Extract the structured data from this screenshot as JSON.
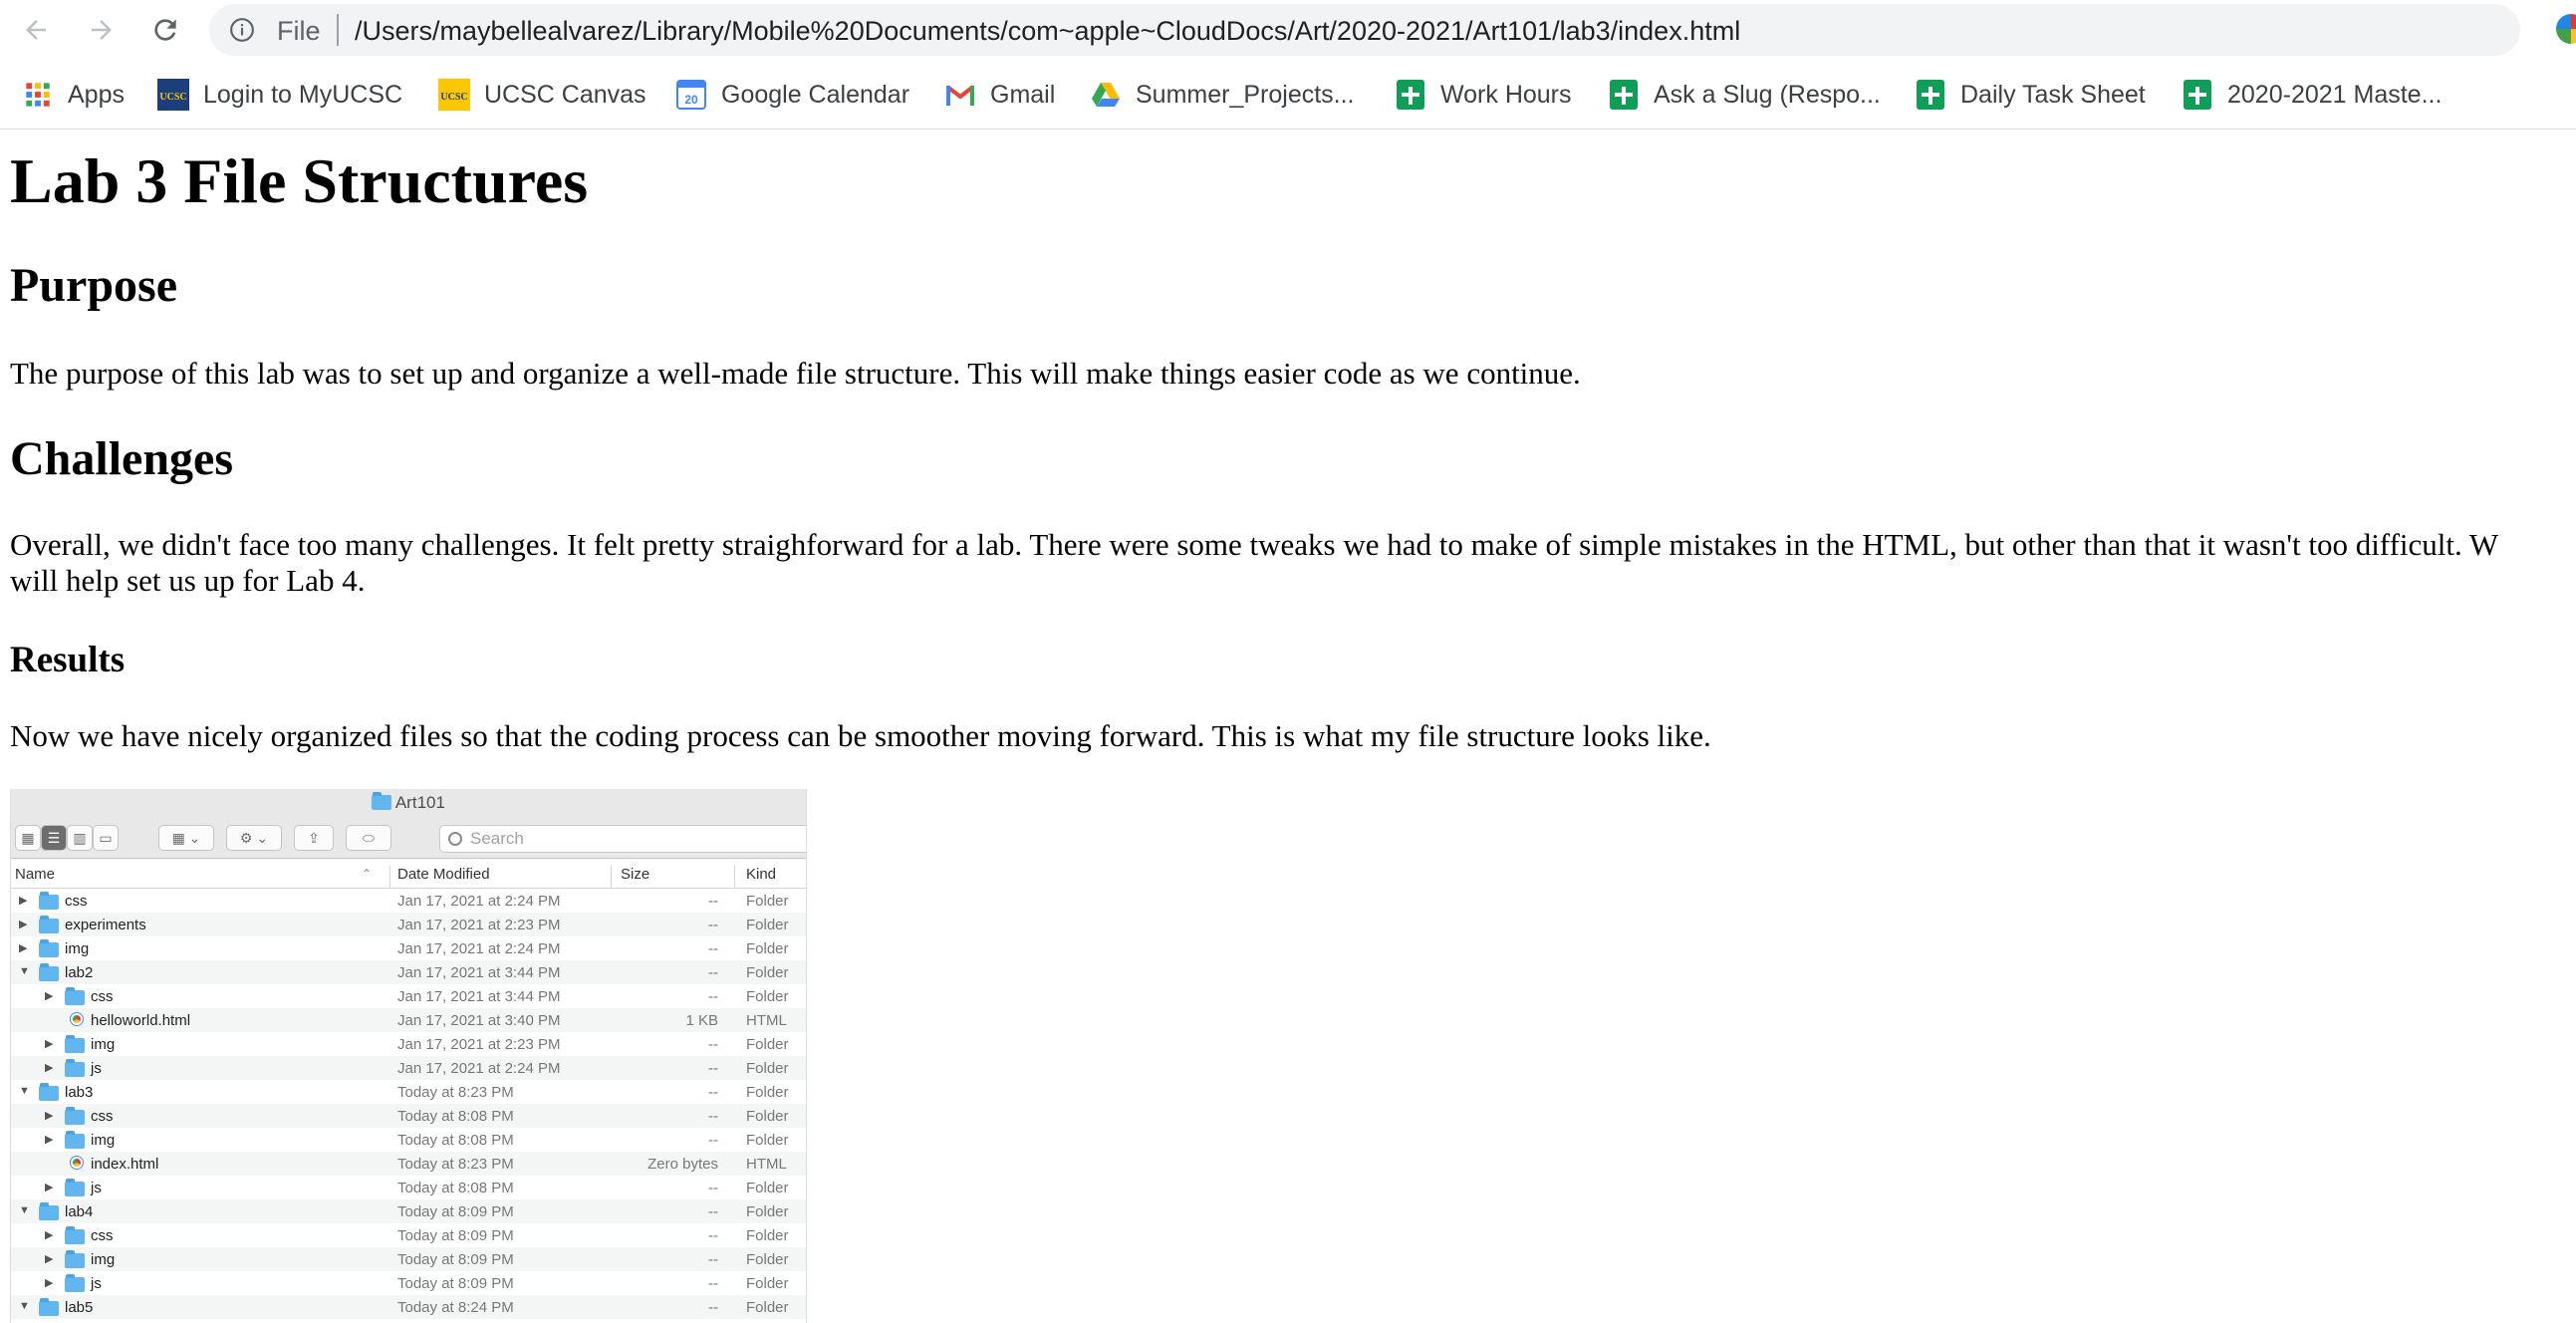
{
  "browser": {
    "scheme_label": "File",
    "url": "/Users/maybellealvarez/Library/Mobile%20Documents/com~apple~CloudDocs/Art/2020-2021/Art101/lab3/index.html"
  },
  "bookmarks": [
    {
      "label": "Apps",
      "icon": "apps-grid-icon"
    },
    {
      "label": "Login to MyUCSC",
      "icon": "ucsc-icon"
    },
    {
      "label": "UCSC Canvas",
      "icon": "ucsc-canvas-icon"
    },
    {
      "label": "Google Calendar",
      "icon": "google-calendar-icon"
    },
    {
      "label": "Gmail",
      "icon": "gmail-icon"
    },
    {
      "label": "Summer_Projects...",
      "icon": "google-drive-icon"
    },
    {
      "label": "Work Hours",
      "icon": "google-sheets-icon"
    },
    {
      "label": "Ask a Slug (Respo...",
      "icon": "google-sheets-icon"
    },
    {
      "label": "Daily Task Sheet",
      "icon": "google-sheets-icon"
    },
    {
      "label": "2020-2021 Maste...",
      "icon": "google-sheets-icon"
    }
  ],
  "page": {
    "title": "Lab 3 File Structures",
    "purpose_heading": "Purpose",
    "purpose_text": "The purpose of this lab was to set up and organize a well-made file structure. This will make things easier code as we continue.",
    "challenges_heading": "Challenges",
    "challenges_line1": "Overall, we didn't face too many challenges. It felt pretty straighforward for a lab. There were some tweaks we had to make of simple mistakes in the HTML, but other than that it wasn't too difficult. W",
    "challenges_line2": "will help set us up for Lab 4.",
    "results_heading": "Results",
    "results_text": "Now we have nicely organized files so that the coding process can be smoother moving forward. This is what my file structure looks like."
  },
  "finder": {
    "window_title": "Art101",
    "search_placeholder": "Search",
    "columns": {
      "name": "Name",
      "date": "Date Modified",
      "size": "Size",
      "kind": "Kind"
    },
    "rows": [
      {
        "name": "css",
        "date": "Jan 17, 2021 at 2:24 PM",
        "size": "--",
        "kind": "Folder",
        "level": 0,
        "expanded": false,
        "type": "folder"
      },
      {
        "name": "experiments",
        "date": "Jan 17, 2021 at 2:23 PM",
        "size": "--",
        "kind": "Folder",
        "level": 0,
        "expanded": false,
        "type": "folder"
      },
      {
        "name": "img",
        "date": "Jan 17, 2021 at 2:24 PM",
        "size": "--",
        "kind": "Folder",
        "level": 0,
        "expanded": false,
        "type": "folder"
      },
      {
        "name": "lab2",
        "date": "Jan 17, 2021 at 3:44 PM",
        "size": "--",
        "kind": "Folder",
        "level": 0,
        "expanded": true,
        "type": "folder"
      },
      {
        "name": "css",
        "date": "Jan 17, 2021 at 3:44 PM",
        "size": "--",
        "kind": "Folder",
        "level": 1,
        "expanded": false,
        "type": "folder"
      },
      {
        "name": "helloworld.html",
        "date": "Jan 17, 2021 at 3:40 PM",
        "size": "1 KB",
        "kind": "HTML",
        "level": 1,
        "expanded": null,
        "type": "file"
      },
      {
        "name": "img",
        "date": "Jan 17, 2021 at 2:23 PM",
        "size": "--",
        "kind": "Folder",
        "level": 1,
        "expanded": false,
        "type": "folder"
      },
      {
        "name": "js",
        "date": "Jan 17, 2021 at 2:24 PM",
        "size": "--",
        "kind": "Folder",
        "level": 1,
        "expanded": false,
        "type": "folder"
      },
      {
        "name": "lab3",
        "date": "Today at 8:23 PM",
        "size": "--",
        "kind": "Folder",
        "level": 0,
        "expanded": true,
        "type": "folder"
      },
      {
        "name": "css",
        "date": "Today at 8:08 PM",
        "size": "--",
        "kind": "Folder",
        "level": 1,
        "expanded": false,
        "type": "folder"
      },
      {
        "name": "img",
        "date": "Today at 8:08 PM",
        "size": "--",
        "kind": "Folder",
        "level": 1,
        "expanded": false,
        "type": "folder"
      },
      {
        "name": "index.html",
        "date": "Today at 8:23 PM",
        "size": "Zero bytes",
        "kind": "HTML",
        "level": 1,
        "expanded": null,
        "type": "file"
      },
      {
        "name": "js",
        "date": "Today at 8:08 PM",
        "size": "--",
        "kind": "Folder",
        "level": 1,
        "expanded": false,
        "type": "folder"
      },
      {
        "name": "lab4",
        "date": "Today at 8:09 PM",
        "size": "--",
        "kind": "Folder",
        "level": 0,
        "expanded": true,
        "type": "folder"
      },
      {
        "name": "css",
        "date": "Today at 8:09 PM",
        "size": "--",
        "kind": "Folder",
        "level": 1,
        "expanded": false,
        "type": "folder"
      },
      {
        "name": "img",
        "date": "Today at 8:09 PM",
        "size": "--",
        "kind": "Folder",
        "level": 1,
        "expanded": false,
        "type": "folder"
      },
      {
        "name": "js",
        "date": "Today at 8:09 PM",
        "size": "--",
        "kind": "Folder",
        "level": 1,
        "expanded": false,
        "type": "folder"
      },
      {
        "name": "lab5",
        "date": "Today at 8:24 PM",
        "size": "--",
        "kind": "Folder",
        "level": 0,
        "expanded": true,
        "type": "folder"
      }
    ]
  }
}
